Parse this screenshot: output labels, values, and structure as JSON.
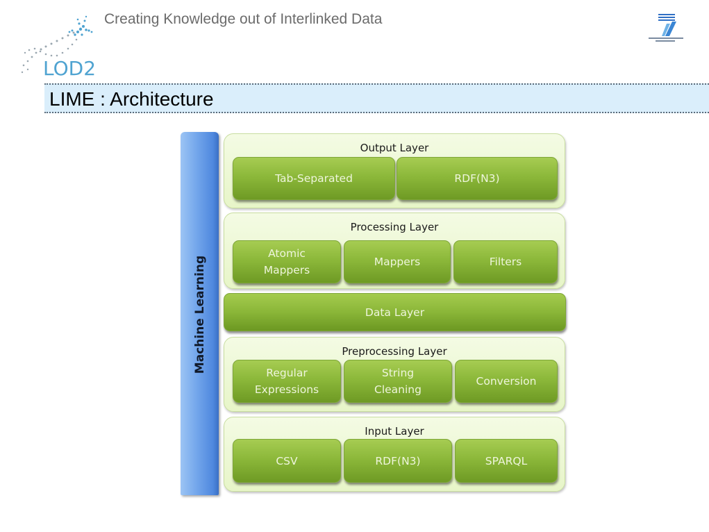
{
  "header": {
    "tagline": "Creating Knowledge out of Interlinked Data",
    "logo_text": "LOD2",
    "partner_logo": "fp7-logo",
    "slide_title": "LIME : Architecture"
  },
  "diagram": {
    "side_bar_label": "Machine Learning",
    "layers": [
      {
        "title": "Output Layer",
        "components": [
          "Tab-Separated",
          "RDF(N3)"
        ]
      },
      {
        "title": "Processing Layer",
        "components": [
          "Atomic Mappers",
          "Mappers",
          "Filters"
        ]
      },
      {
        "title": "Data Layer",
        "components": []
      },
      {
        "title": "Preprocessing Layer",
        "components": [
          "Regular Expressions",
          "String Cleaning",
          "Conversion"
        ]
      },
      {
        "title": "Input Layer",
        "components": [
          "CSV",
          "RDF(N3)",
          "SPARQL"
        ]
      }
    ]
  },
  "colors": {
    "title_bar_bg": "#daeefb",
    "ml_bar": "#4f88de",
    "component_green": "#8cb83a",
    "layer_bg": "#e7f5c8",
    "logo_blue": "#4fa3d1"
  }
}
